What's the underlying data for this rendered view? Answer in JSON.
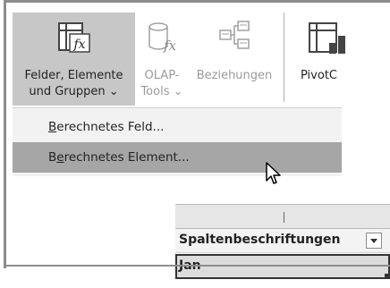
{
  "ribbon": {
    "felder_button": {
      "line1": "Felder, Elemente",
      "line2": "und Gruppen",
      "chevron": "⌄",
      "icon": "fx-table-icon"
    },
    "olap_button": {
      "line1": "OLAP-",
      "line2": "Tools",
      "chevron": "⌄",
      "icon": "cylinder-fx-icon"
    },
    "beziehungen_button": {
      "line1": "Beziehungen",
      "icon": "relationships-icon"
    },
    "pivot_button": {
      "line1": "PivotC",
      "icon": "pivotchart-icon"
    }
  },
  "menu": {
    "item1": {
      "underline_char": "B",
      "rest": "erechnetes Feld..."
    },
    "item2": {
      "pre": "B",
      "underline_char": "e",
      "rest": "rechnetes Element..."
    }
  },
  "sheet": {
    "header_row_text": "Spaltenbeschriftungen",
    "selected_cell_text": "Jan"
  },
  "colors": {
    "ribbon_selected_bg": "#c7c7c7",
    "menu_bg": "#f2f2f2",
    "menu_hover_bg": "#a6a6a6",
    "disabled_text": "#9a9a9a"
  }
}
